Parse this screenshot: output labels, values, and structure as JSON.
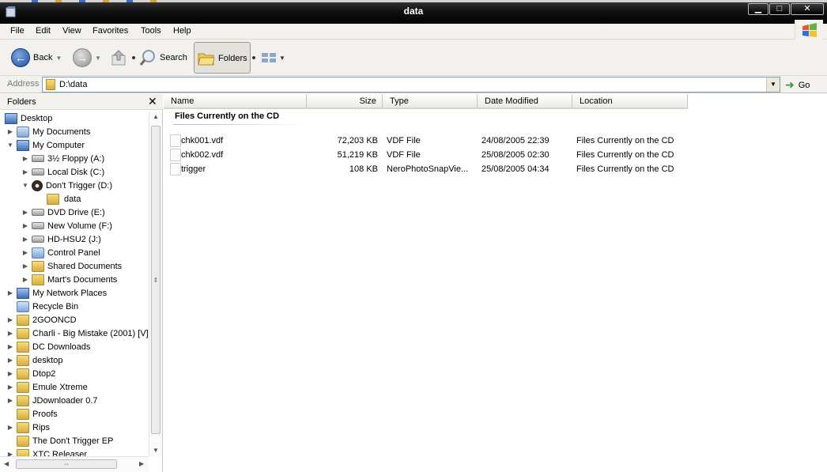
{
  "window": {
    "title": "data"
  },
  "menu": [
    "File",
    "Edit",
    "View",
    "Favorites",
    "Tools",
    "Help"
  ],
  "toolbar": {
    "back": "Back",
    "search": "Search",
    "folders": "Folders"
  },
  "address": {
    "label": "Address",
    "value": "D:\\data",
    "go": "Go"
  },
  "folders_pane": {
    "title": "Folders",
    "tree": [
      {
        "label": "Desktop",
        "icon": "desktop-icon",
        "expander": ""
      },
      {
        "label": "My Documents",
        "icon": "my-documents-icon",
        "expander": "▶"
      },
      {
        "label": "My Computer",
        "icon": "my-computer-icon",
        "expander": "▼"
      },
      {
        "label": "3½ Floppy (A:)",
        "icon": "floppy-drive-icon",
        "expander": "▶"
      },
      {
        "label": "Local Disk (C:)",
        "icon": "hard-disk-icon",
        "expander": "▶"
      },
      {
        "label": "Don't Trigger (D:)",
        "icon": "cd-drive-icon",
        "expander": "▼"
      },
      {
        "label": "data",
        "icon": "folder-icon",
        "expander": ""
      },
      {
        "label": "DVD Drive (E:)",
        "icon": "dvd-drive-icon",
        "expander": "▶"
      },
      {
        "label": "New Volume (F:)",
        "icon": "hard-disk-icon",
        "expander": "▶"
      },
      {
        "label": "HD-HSU2 (J:)",
        "icon": "hard-disk-icon",
        "expander": "▶"
      },
      {
        "label": "Control Panel",
        "icon": "control-panel-icon",
        "expander": "▶"
      },
      {
        "label": "Shared Documents",
        "icon": "folder-icon",
        "expander": "▶"
      },
      {
        "label": "Mart's Documents",
        "icon": "folder-icon",
        "expander": "▶"
      },
      {
        "label": "My Network Places",
        "icon": "network-places-icon",
        "expander": "▶"
      },
      {
        "label": "Recycle Bin",
        "icon": "recycle-bin-icon",
        "expander": ""
      },
      {
        "label": "2GOONCD",
        "icon": "folder-icon",
        "expander": "▶"
      },
      {
        "label": "Charli - Big Mistake (2001) [V]",
        "icon": "folder-icon",
        "expander": "▶"
      },
      {
        "label": "DC Downloads",
        "icon": "folder-icon",
        "expander": "▶"
      },
      {
        "label": "desktop",
        "icon": "folder-icon",
        "expander": "▶"
      },
      {
        "label": "Dtop2",
        "icon": "folder-icon",
        "expander": "▶"
      },
      {
        "label": "Emule Xtreme",
        "icon": "folder-icon",
        "expander": "▶"
      },
      {
        "label": "JDownloader 0.7",
        "icon": "folder-icon",
        "expander": "▶"
      },
      {
        "label": "Proofs",
        "icon": "folder-icon",
        "expander": ""
      },
      {
        "label": "Rips",
        "icon": "folder-icon",
        "expander": "▶"
      },
      {
        "label": "The Don't Trigger EP",
        "icon": "folder-icon",
        "expander": ""
      },
      {
        "label": "XTC Releaser",
        "icon": "folder-icon",
        "expander": "▶"
      }
    ]
  },
  "file_list": {
    "columns": [
      "Name",
      "Size",
      "Type",
      "Date Modified",
      "Location"
    ],
    "group": "Files Currently on the CD",
    "rows": [
      {
        "name": "chk001.vdf",
        "size": "72,203 KB",
        "type": "VDF File",
        "date": "24/08/2005 22:39",
        "location": "Files Currently on the CD"
      },
      {
        "name": "chk002.vdf",
        "size": "51,219 KB",
        "type": "VDF File",
        "date": "25/08/2005 02:30",
        "location": "Files Currently on the CD"
      },
      {
        "name": "trigger",
        "size": "108 KB",
        "type": "NeroPhotoSnapVie...",
        "date": "25/08/2005 04:34",
        "location": "Files Currently on the CD"
      }
    ]
  }
}
